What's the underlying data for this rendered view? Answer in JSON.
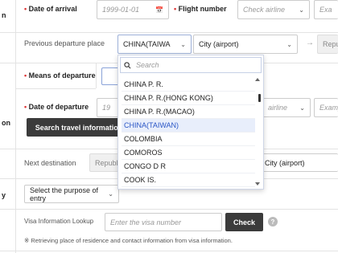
{
  "left_column": {
    "arrival_suffix": "n",
    "departure_suffix": "on",
    "purpose_suffix": "y"
  },
  "arrival": {
    "label": "Date of arrival",
    "date_placeholder": "1999-01-01",
    "flight_label": "Flight number",
    "airline_placeholder": "Check airline",
    "example_placeholder": "Exa"
  },
  "prev_departure": {
    "label": "Previous departure place",
    "country_value": "CHINA(TAIWA",
    "city_value": "City (airport)",
    "repub_value": "Repu"
  },
  "means": {
    "label": "Means of departure"
  },
  "departure": {
    "label": "Date of departure",
    "date_fragment": "19",
    "airline_fragment": "airline",
    "example_fragment": "Examp",
    "search_button": "Search travel information"
  },
  "next_destination": {
    "label": "Next destination",
    "country_fragment": "Republ",
    "city_value": "City (airport)"
  },
  "purpose": {
    "select_value": "Select the purpose of entry"
  },
  "visa": {
    "label": "Visa Information Lookup",
    "placeholder": "Enter the visa number",
    "check_button": "Check",
    "help_icon_text": "?",
    "note": "※ Retrieving place of residence and contact information from visa information."
  },
  "dropdown": {
    "search_placeholder": "Search",
    "items": [
      "CHINA P. R.",
      "CHINA P. R.(HONG KONG)",
      "CHINA P. R.(MACAO)",
      "CHINA(TAIWAN)",
      "COLOMBIA",
      "COMOROS",
      "CONGO D R",
      "COOK IS."
    ],
    "selected_index": 3
  },
  "colors": {
    "required": "#d33333",
    "selected_item_bg": "#e8eefb",
    "selected_item_text": "#2a56c6",
    "dark_button": "#3b3b3b"
  }
}
